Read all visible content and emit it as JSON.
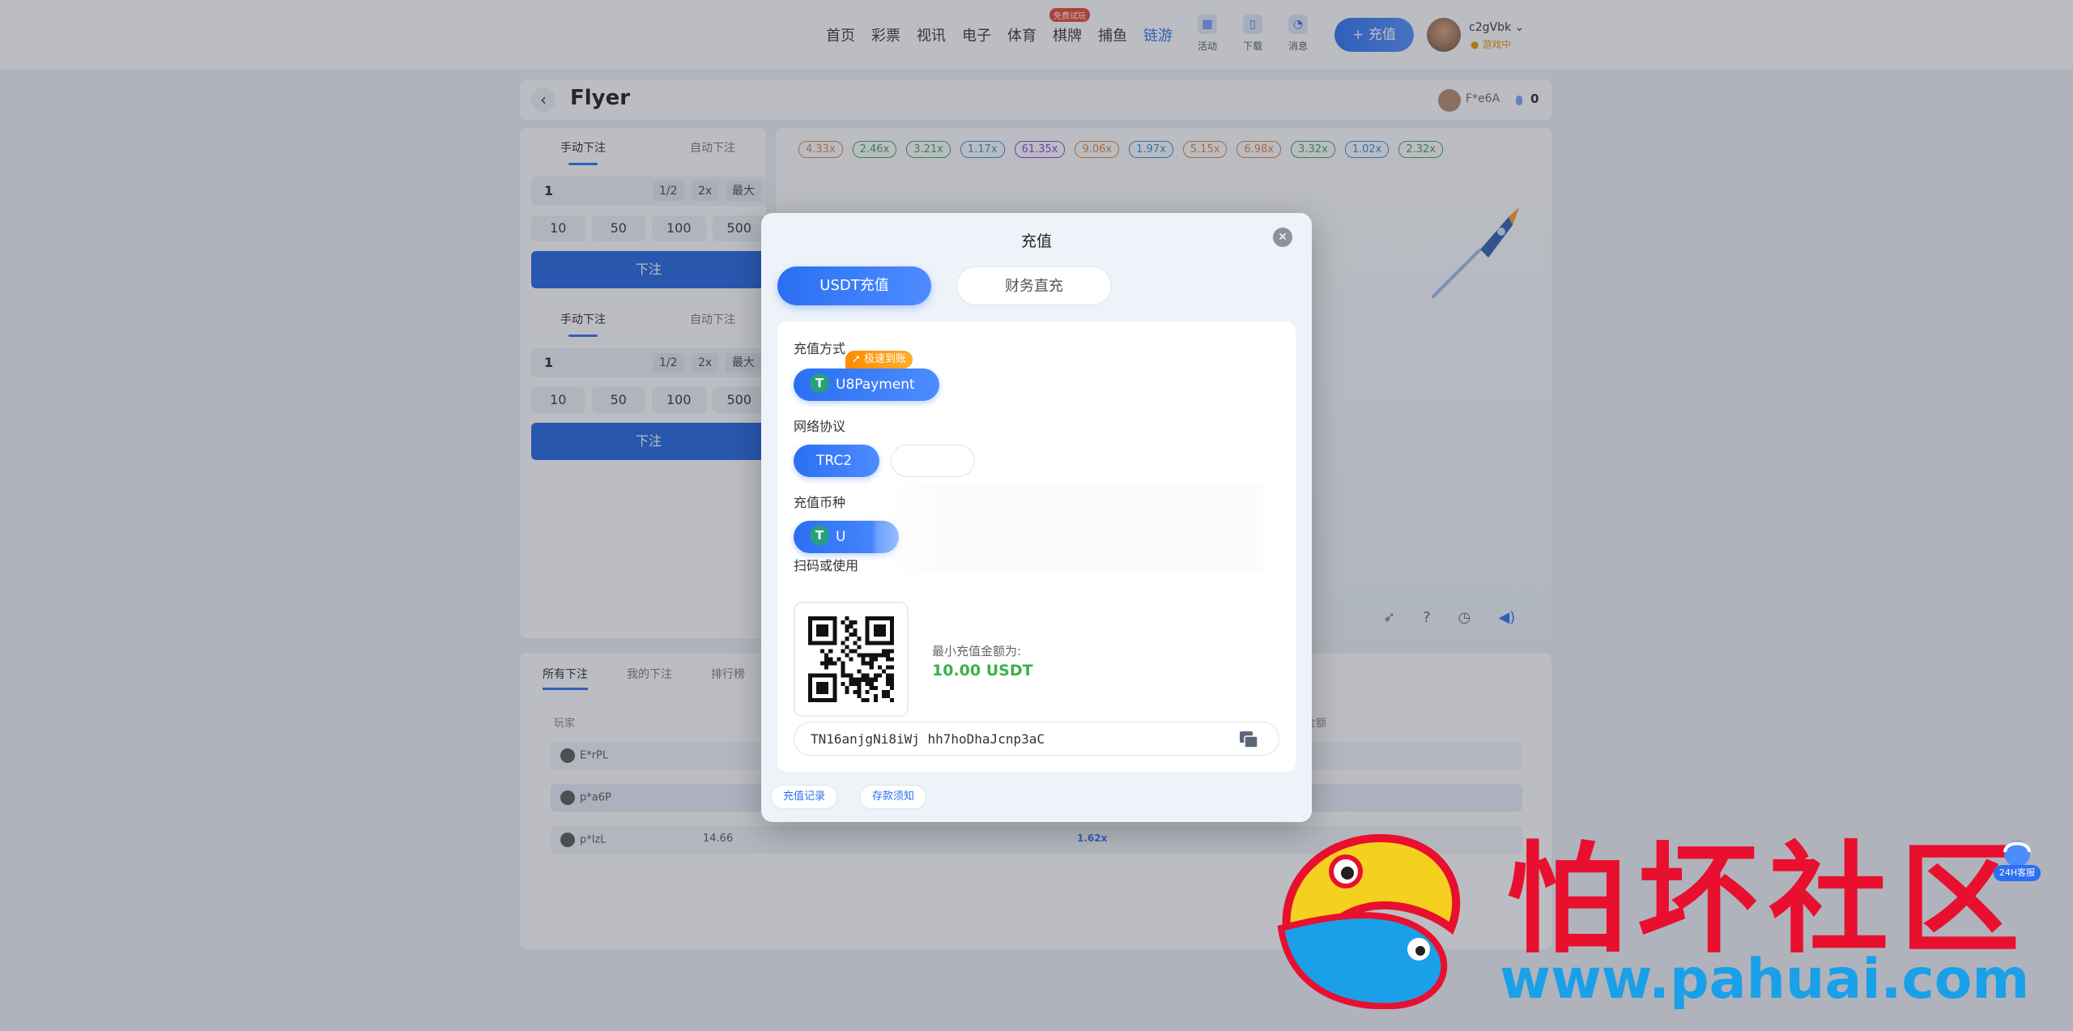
{
  "nav": {
    "items": [
      "首页",
      "彩票",
      "视讯",
      "电子",
      "体育",
      "棋牌",
      "捕鱼",
      "链游"
    ],
    "active": "链游",
    "tag": "免费试玩"
  },
  "toolbar": {
    "activity": "活动",
    "download": "下载",
    "message": "消息",
    "recharge": "+ 充值"
  },
  "user": {
    "name": "c2gVbk",
    "status": "游戏中"
  },
  "game": {
    "title": "Flyer",
    "header_user": "F*e6A",
    "header_balance": "0"
  },
  "bet_panels": [
    {
      "tab_manual": "手动下注",
      "tab_auto": "自动下注",
      "amount": "1",
      "half": "1/2",
      "double": "2x",
      "max": "最大",
      "chips": [
        "10",
        "50",
        "100",
        "500"
      ],
      "bet_button": "下注"
    },
    {
      "tab_manual": "手动下注",
      "tab_auto": "自动下注",
      "amount": "1",
      "half": "1/2",
      "double": "2x",
      "max": "最大",
      "chips": [
        "10",
        "50",
        "100",
        "500"
      ],
      "bet_button": "下注"
    }
  ],
  "multipliers": [
    {
      "v": "4.33x",
      "c": "#e2803a"
    },
    {
      "v": "2.46x",
      "c": "#3aa54a"
    },
    {
      "v": "3.21x",
      "c": "#3aa54a"
    },
    {
      "v": "1.17x",
      "c": "#2b8fd6"
    },
    {
      "v": "61.35x",
      "c": "#8b3ad6"
    },
    {
      "v": "9.06x",
      "c": "#e2803a"
    },
    {
      "v": "1.97x",
      "c": "#2b8fd6"
    },
    {
      "v": "5.15x",
      "c": "#e2803a"
    },
    {
      "v": "6.98x",
      "c": "#e2803a"
    },
    {
      "v": "3.32x",
      "c": "#3aa54a"
    },
    {
      "v": "1.02x",
      "c": "#2b8fd6"
    },
    {
      "v": "2.32x",
      "c": "#3aa54a"
    }
  ],
  "history": {
    "tabs": [
      "所有下注",
      "我的下注",
      "排行榜"
    ],
    "col_player": "玩家",
    "col_amount": "金额",
    "rows": [
      {
        "player": "E*rPL",
        "amount": "",
        "mult": ""
      },
      {
        "player": "p*a6P",
        "amount": "",
        "mult": ""
      },
      {
        "player": "p*lzL",
        "amount": "14.66",
        "mult": "1.62x"
      }
    ]
  },
  "modal": {
    "title": "充值",
    "tab_usdt": "USDT充值",
    "tab_finance": "财务直充",
    "method_label": "充值方式",
    "fast_badge": "极速到账",
    "method": "U8Payment",
    "network_label": "网络协议",
    "network": "TRC2",
    "currency_label": "充值币种",
    "currency": "U",
    "scan_label": "扫码或使用",
    "min_label": "最小充值金额为:",
    "min_value": "10.00 USDT",
    "address": "TN16anjgNi8iWj hh7hoDhaJcnp3aC",
    "record_link": "充值记录",
    "notice_link": "存款须知"
  },
  "watermark": {
    "text": "怕坏社区",
    "url": "www.pahuai.com",
    "cs_label": "24H客服"
  },
  "colors": {
    "accent": "#2b6ff2",
    "success": "#3cb14a",
    "usdt": "#26a17b",
    "badge": "#ff8a00",
    "watermark_red": "#e8102e",
    "watermark_blue": "#1aa0e8"
  }
}
